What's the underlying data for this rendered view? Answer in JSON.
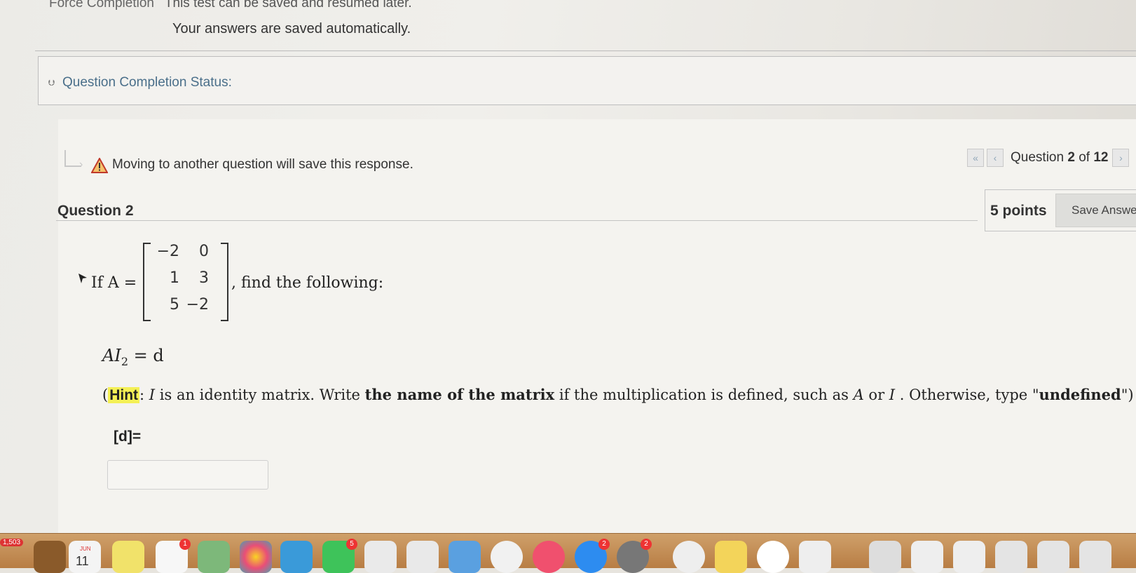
{
  "header": {
    "force_completion_label": "Force Completion",
    "force_completion_text": "This test can be saved and resumed later.",
    "autosave_text": "Your answers are saved automatically."
  },
  "completion_status": {
    "label": "Question Completion Status:"
  },
  "warning": {
    "text": "Moving to another question will save this response."
  },
  "navigation": {
    "prefix": "Question",
    "current": "2",
    "of": "of",
    "total": "12"
  },
  "question": {
    "title": "Question 2",
    "points": "5 points",
    "save_label": "Save Answer",
    "intro_if": "If",
    "matrix_name": "A =",
    "matrix": [
      [
        "−2",
        "0"
      ],
      [
        "1",
        "3"
      ],
      [
        "5",
        "−2"
      ]
    ],
    "find_text": ", find the following:",
    "equation_lhs": "AI",
    "equation_sub": "2",
    "equation_rhs": "= d",
    "hint": {
      "open": "(",
      "label": "Hint",
      "colon": ":",
      "i_symbol": "I",
      "t1": " is an identity matrix. Write ",
      "bold1": "the name of the matrix",
      "t2": " if the multiplication is defined, such as ",
      "a_symbol": "A",
      "t3": " or ",
      "i2_symbol": "I",
      "t4": " . Otherwise, type \"",
      "bold2": "undefined",
      "t5": "\")"
    },
    "answer_label": "[d]=",
    "answer_value": ""
  },
  "dock": {
    "count_badge": "1,503",
    "calendar_month": "JUN",
    "calendar_day": "11",
    "badges": [
      "1",
      "5",
      "2",
      "2"
    ],
    "colors": {
      "dock_top": "#cfa06a",
      "dock_bottom": "#b87d44",
      "badge": "#e33333",
      "highlight": "#f4f055",
      "link_blue": "#4a6f8a"
    }
  }
}
